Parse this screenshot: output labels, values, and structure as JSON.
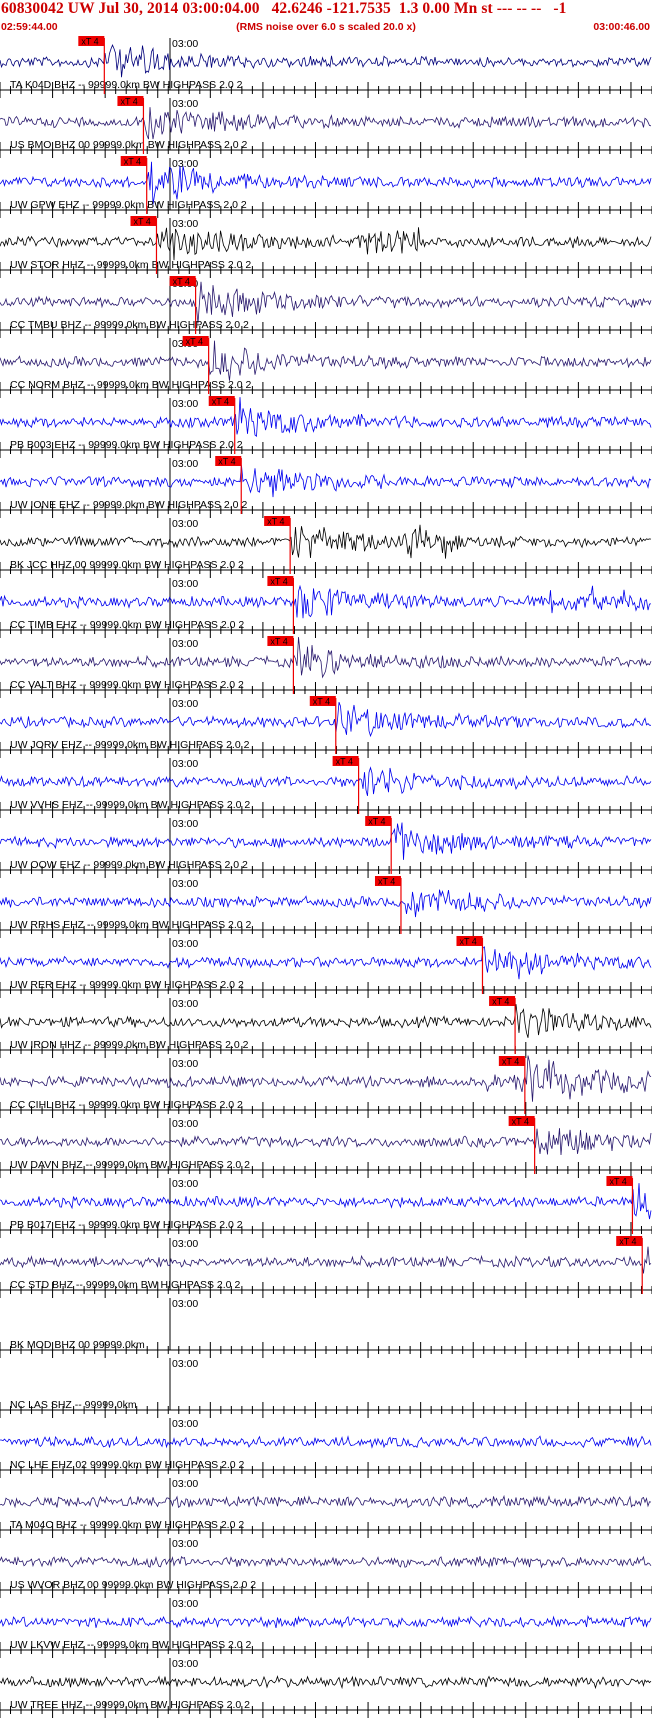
{
  "header": {
    "title": "60830042 UW Jul 30, 2014 03:00:04.00   42.6246 -121.7535  1.3 0.00 Mn st --- -- --   -1",
    "start_time": "02:59:44.00",
    "rms_note": "(RMS noise over 6.0 s scaled 20.0 x)",
    "end_time": "03:00:46.00"
  },
  "minute_label": "03:00",
  "pick_label": "xT 4",
  "colors": {
    "background": "#ffffff",
    "header_text": "#cc0000",
    "pick": "#ee0000",
    "axis": "#000000",
    "trace_palette": [
      "#00007a",
      "#2a1a6e",
      "#0000ee",
      "#000000"
    ]
  },
  "traces": [
    {
      "label": "TA K04D BHZ -- 99999.0km BW  HIGHPASS  2.0  2",
      "color": "#00007a",
      "pick": 0.16
    },
    {
      "label": "US BMO BHZ 00 99999.0km BW  HIGHPASS  2.0  2",
      "color": "#2a1a6e",
      "pick": 0.22
    },
    {
      "label": "UW GPW EHZ -- 99999.0km BW  HIGHPASS  2.0  2",
      "color": "#0000ee",
      "pick": 0.225
    },
    {
      "label": "UW STOR HHZ -- 99999.0km BW  HIGHPASS  2.0  2",
      "color": "#000000",
      "pick": 0.24
    },
    {
      "label": "CC TMBU BHZ -- 99999.0km BW  HIGHPASS  2.0  2",
      "color": "#2a1a6e",
      "pick": 0.3
    },
    {
      "label": "CC NORM BHZ -- 99999.0km BW  HIGHPASS  2.0  2",
      "color": "#2a1a6e",
      "pick": 0.32
    },
    {
      "label": "PB B003 EHZ -- 99999.0km BW  HIGHPASS  2.0  2",
      "color": "#0000ee",
      "pick": 0.36
    },
    {
      "label": "UW IONE EHZ -- 99999.0km BW  HIGHPASS  2.0  2",
      "color": "#0000ee",
      "pick": 0.37
    },
    {
      "label": "BK JCC HHZ 00 99999.0km BW  HIGHPASS  2.0  2",
      "color": "#000000",
      "pick": 0.445
    },
    {
      "label": "CC TIMB EHZ -- 99999.0km BW  HIGHPASS  2.0  2",
      "color": "#0000ee",
      "pick": 0.45
    },
    {
      "label": "CC VALT BHZ -- 99999.0km BW  HIGHPASS  2.0  2",
      "color": "#2a1a6e",
      "pick": 0.45
    },
    {
      "label": "UW JORV EHZ -- 99999.0km BW  HIGHPASS  2.0  2",
      "color": "#0000ee",
      "pick": 0.515
    },
    {
      "label": "UW VVHS EHZ -- 99999.0km BW  HIGHPASS  2.0  2",
      "color": "#0000ee",
      "pick": 0.55
    },
    {
      "label": "UW OOW EHZ -- 99999.0km BW  HIGHPASS  2.0  2",
      "color": "#0000ee",
      "pick": 0.6
    },
    {
      "label": "UW RRHS EHZ -- 99999.0km BW  HIGHPASS  2.0  2",
      "color": "#0000ee",
      "pick": 0.615
    },
    {
      "label": "UW RER EHZ -- 99999.0km BW  HIGHPASS  2.0  2",
      "color": "#0000ee",
      "pick": 0.74
    },
    {
      "label": "UW IRON HHZ -- 99999.0km BW  HIGHPASS  2.0  2",
      "color": "#000000",
      "pick": 0.79
    },
    {
      "label": "CC CIHL BHZ -- 99999.0km BW  HIGHPASS  2.0  2",
      "color": "#2a1a6e",
      "pick": 0.805
    },
    {
      "label": "UW DAVN BHZ -- 99999.0km BW  HIGHPASS  2.0  2",
      "color": "#2a1a6e",
      "pick": 0.82
    },
    {
      "label": "PB B017 EHZ -- 99999.0km BW  HIGHPASS  2.0  2",
      "color": "#0000ee",
      "pick": 0.97
    },
    {
      "label": "CC STD BHZ -- 99999.0km BW  HIGHPASS  2.0  2",
      "color": "#2a1a6e",
      "pick": 0.985
    },
    {
      "label": "BK MOD BHZ 00 99999.0km",
      "color": "#000000",
      "flat": true
    },
    {
      "label": "NC LAS SHZ -- 99999.0km",
      "color": "#000000",
      "flat": true
    },
    {
      "label": "NC LHE EHZ 02 99999.0km BW  HIGHPASS  2.0  2",
      "color": "#0000ee"
    },
    {
      "label": "TA M04C BHZ -- 99999.0km BW  HIGHPASS  2.0  2",
      "color": "#2a1a6e"
    },
    {
      "label": "US WVOR BHZ 00 99999.0km BW  HIGHPASS  2.0  2",
      "color": "#2a1a6e"
    },
    {
      "label": "UW LKVW EHZ -- 99999.0km BW  HIGHPASS  2.0  2",
      "color": "#0000ee"
    },
    {
      "label": "UW TREE HHZ -- 99999.0km BW  HIGHPASS  2.0  2",
      "color": "#000000"
    }
  ]
}
